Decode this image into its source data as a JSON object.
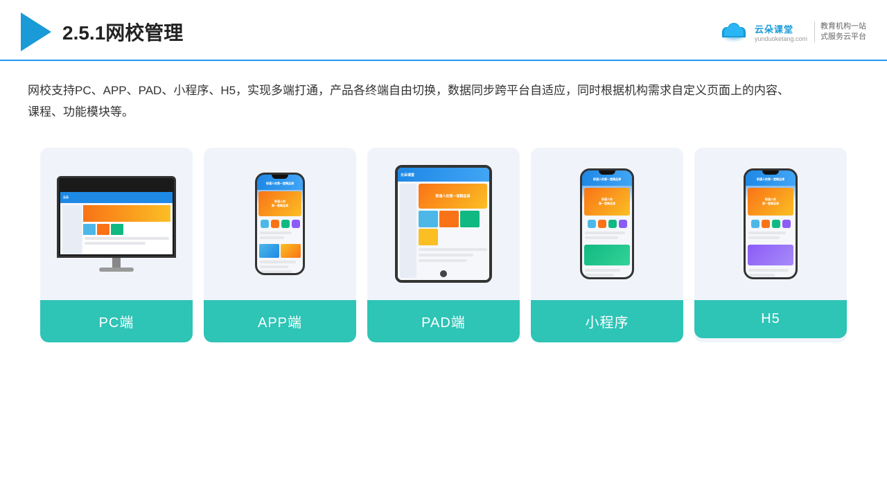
{
  "header": {
    "title": "2.5.1网校管理",
    "brand_name": "云朵课堂",
    "brand_url": "yunduoketang.com",
    "brand_slogan": "教育机构一站\n式服务云平台"
  },
  "description": "网校支持PC、APP、PAD、小程序、H5，实现多端打通，产品各终端自由切换，数据同步跨平台自适应，同时根据机构需求自定义页面上的内容、课程、功能模块等。",
  "cards": [
    {
      "id": "pc",
      "label": "PC端"
    },
    {
      "id": "app",
      "label": "APP端"
    },
    {
      "id": "pad",
      "label": "PAD端"
    },
    {
      "id": "miniprogram",
      "label": "小程序"
    },
    {
      "id": "h5",
      "label": "H5"
    }
  ]
}
